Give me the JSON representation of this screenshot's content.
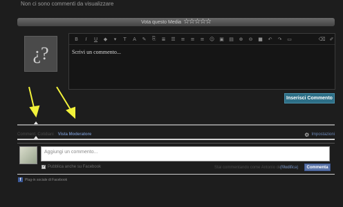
{
  "comments": {
    "empty_text": "Non ci sono commenti da visualizzare"
  },
  "rating": {
    "label": "Vota questo Media",
    "stars": "☆☆☆☆☆"
  },
  "avatar": {
    "glyph": "¿?"
  },
  "editor": {
    "toolbar_icons": [
      "bold-icon",
      "italic-icon",
      "underline-icon",
      "font-color-icon",
      "drop-icon",
      "font-size-icon",
      "font-family-icon",
      "strikethrough-icon",
      "quote-icon",
      "align-icon",
      "list-icon",
      "ordered-list-icon",
      "indent-icon",
      "outdent-icon",
      "smiley-icon",
      "image-icon",
      "video-icon",
      "link-icon",
      "unlink-icon",
      "code-icon",
      "undo-icon",
      "redo-icon",
      "eraser-icon",
      "source-icon"
    ],
    "placeholder": "Scrivi un commento..."
  },
  "submit": {
    "label": "Inserisci Commento"
  },
  "facebook": {
    "tab_comments": "Comment. Cotidiani",
    "tab_moderate": "Vista Moderatore",
    "settings": "Impostazioni",
    "input_placeholder": "Aggiungi un commento...",
    "checkbox_label": "Pubblica anche su Facebook",
    "as_text": "Stai commentando come Antonio de Turris",
    "change_link": "(Modifica)",
    "comment_button": "Commenta",
    "plugin_label": "Plug-in sociale di Facebook"
  },
  "colors": {
    "accent": "#2d6f87",
    "facebook_blue": "#5b74a8",
    "arrow": "#f2f23a"
  }
}
